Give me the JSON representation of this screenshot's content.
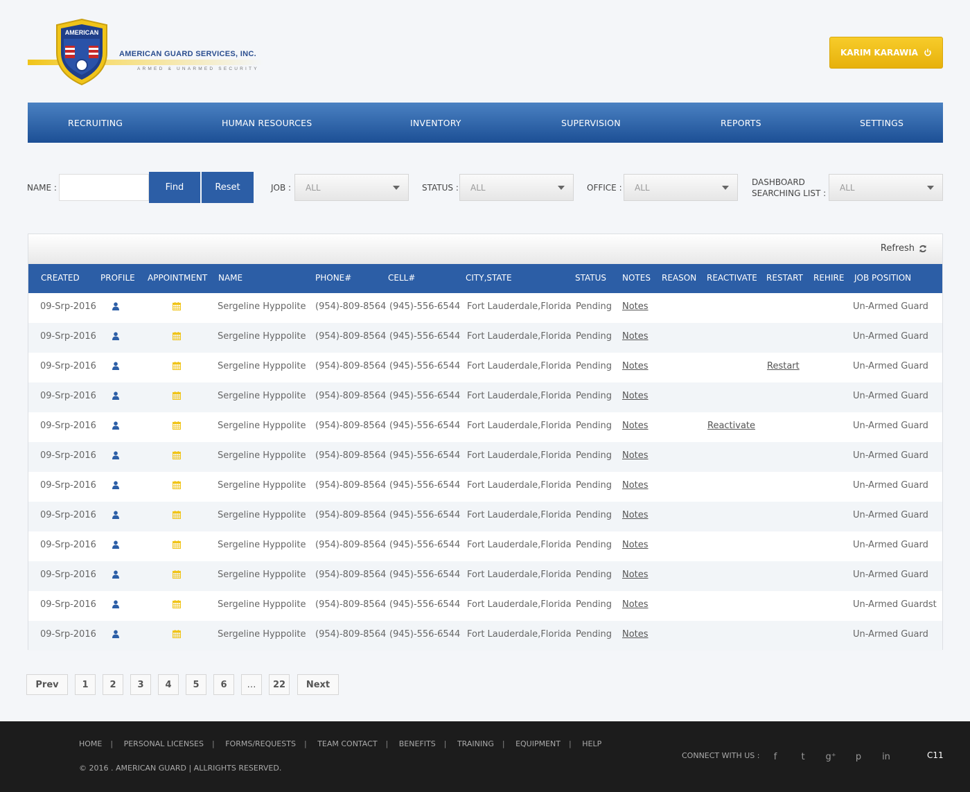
{
  "brand": {
    "badge_text": "AMERICAN",
    "name": "AMERICAN GUARD SERVICES, INC.",
    "tagline": "ARMED & UNARMED SECURITY",
    "colors": {
      "gold": "#f0c419",
      "blue": "#2c5ea6"
    }
  },
  "user": {
    "name": "KARIM KARAWIA",
    "icon": "power-icon"
  },
  "nav": [
    "RECRUITING",
    "HUMAN RESOURCES",
    "INVENTORY",
    "SUPERVISION",
    "REPORTS",
    "SETTINGS"
  ],
  "filters": {
    "name_label": "NAME :",
    "name_value": "",
    "find": "Find",
    "reset": "Reset",
    "job_label": "JOB :",
    "job_value": "ALL",
    "status_label": "STATUS :",
    "status_value": "ALL",
    "office_label": "OFFICE :",
    "office_value": "ALL",
    "dashboard_label_1": "DASHBOARD",
    "dashboard_label_2": "SEARCHING LIST  :",
    "dashboard_value": "ALL"
  },
  "table": {
    "refresh": "Refresh",
    "columns": [
      "CREATED",
      "PROFILE",
      "APPOINTMENT",
      "NAME",
      "PHONE#",
      "CELL#",
      "CITY,STATE",
      "STATUS",
      "NOTES",
      "REASON",
      "REACTIVATE",
      "RESTART",
      "REHIRE",
      "JOB POSITION"
    ],
    "rows": [
      {
        "created": "09-Srp-2016",
        "name": "Sergeline Hyppolite",
        "phone": "(954)-809-8564",
        "cell": "(945)-556-6544",
        "city": "Fort Lauderdale,Florida",
        "status": "Pending",
        "notes": "Notes",
        "reason": "",
        "reactivate": "",
        "restart": "",
        "rehire": "",
        "job": "Un-Armed Guard"
      },
      {
        "created": "09-Srp-2016",
        "name": "Sergeline Hyppolite",
        "phone": "(954)-809-8564",
        "cell": "(945)-556-6544",
        "city": "Fort Lauderdale,Florida",
        "status": "Pending",
        "notes": "Notes",
        "reason": "",
        "reactivate": "",
        "restart": "",
        "rehire": "",
        "job": "Un-Armed Guard"
      },
      {
        "created": "09-Srp-2016",
        "name": "Sergeline Hyppolite",
        "phone": "(954)-809-8564",
        "cell": "(945)-556-6544",
        "city": "Fort Lauderdale,Florida",
        "status": "Pending",
        "notes": "Notes",
        "reason": "",
        "reactivate": "",
        "restart": "Restart",
        "rehire": "",
        "job": "Un-Armed Guard"
      },
      {
        "created": "09-Srp-2016",
        "name": "Sergeline Hyppolite",
        "phone": "(954)-809-8564",
        "cell": "(945)-556-6544",
        "city": "Fort Lauderdale,Florida",
        "status": "Pending",
        "notes": "Notes",
        "reason": "",
        "reactivate": "",
        "restart": "",
        "rehire": "",
        "job": "Un-Armed Guard"
      },
      {
        "created": "09-Srp-2016",
        "name": "Sergeline Hyppolite",
        "phone": "(954)-809-8564",
        "cell": "(945)-556-6544",
        "city": "Fort Lauderdale,Florida",
        "status": "Pending",
        "notes": "Notes",
        "reason": "",
        "reactivate": "Reactivate",
        "restart": "",
        "rehire": "",
        "job": "Un-Armed Guard"
      },
      {
        "created": "09-Srp-2016",
        "name": "Sergeline Hyppolite",
        "phone": "(954)-809-8564",
        "cell": "(945)-556-6544",
        "city": "Fort Lauderdale,Florida",
        "status": "Pending",
        "notes": "Notes",
        "reason": "",
        "reactivate": "",
        "restart": "",
        "rehire": "",
        "job": "Un-Armed Guard"
      },
      {
        "created": "09-Srp-2016",
        "name": "Sergeline Hyppolite",
        "phone": "(954)-809-8564",
        "cell": "(945)-556-6544",
        "city": "Fort Lauderdale,Florida",
        "status": "Pending",
        "notes": "Notes",
        "reason": "",
        "reactivate": "",
        "restart": "",
        "rehire": "",
        "job": "Un-Armed Guard"
      },
      {
        "created": "09-Srp-2016",
        "name": "Sergeline Hyppolite",
        "phone": "(954)-809-8564",
        "cell": "(945)-556-6544",
        "city": "Fort Lauderdale,Florida",
        "status": "Pending",
        "notes": "Notes",
        "reason": "",
        "reactivate": "",
        "restart": "",
        "rehire": "",
        "job": "Un-Armed Guard"
      },
      {
        "created": "09-Srp-2016",
        "name": "Sergeline Hyppolite",
        "phone": "(954)-809-8564",
        "cell": "(945)-556-6544",
        "city": "Fort Lauderdale,Florida",
        "status": "Pending",
        "notes": "Notes",
        "reason": "",
        "reactivate": "",
        "restart": "",
        "rehire": "",
        "job": "Un-Armed Guard"
      },
      {
        "created": "09-Srp-2016",
        "name": "Sergeline Hyppolite",
        "phone": "(954)-809-8564",
        "cell": "(945)-556-6544",
        "city": "Fort Lauderdale,Florida",
        "status": "Pending",
        "notes": "Notes",
        "reason": "",
        "reactivate": "",
        "restart": "",
        "rehire": "",
        "job": "Un-Armed Guard"
      },
      {
        "created": "09-Srp-2016",
        "name": "Sergeline Hyppolite",
        "phone": "(954)-809-8564",
        "cell": "(945)-556-6544",
        "city": "Fort Lauderdale,Florida",
        "status": "Pending",
        "notes": "Notes",
        "reason": "",
        "reactivate": "",
        "restart": "",
        "rehire": "",
        "job": "Un-Armed Guardst"
      },
      {
        "created": "09-Srp-2016",
        "name": "Sergeline Hyppolite",
        "phone": "(954)-809-8564",
        "cell": "(945)-556-6544",
        "city": "Fort Lauderdale,Florida",
        "status": "Pending",
        "notes": "Notes",
        "reason": "",
        "reactivate": "",
        "restart": "",
        "rehire": "",
        "job": "Un-Armed Guard"
      }
    ]
  },
  "pagination": {
    "prev": "Prev",
    "pages": [
      "1",
      "2",
      "3",
      "4",
      "5",
      "6",
      "…",
      "22"
    ],
    "next": "Next"
  },
  "footer": {
    "links": [
      "HOME",
      "PERSONAL LICENSES",
      "FORMS/REQUESTS",
      "TEAM CONTACT",
      "BENEFITS",
      "TRAINING",
      "EQUIPMENT",
      "HELP"
    ],
    "copyright": "© 2016 . AMERICAN GUARD | ALLRIGHTS RESERVED.",
    "connect": "CONNECT WITH US :",
    "social": [
      {
        "icon": "facebook-icon",
        "glyph": "f"
      },
      {
        "icon": "twitter-icon",
        "glyph": "t"
      },
      {
        "icon": "google-plus-icon",
        "glyph": "g⁺"
      },
      {
        "icon": "pinterest-icon",
        "glyph": "p"
      },
      {
        "icon": "linkedin-icon",
        "glyph": "in"
      }
    ],
    "code": "C11"
  }
}
